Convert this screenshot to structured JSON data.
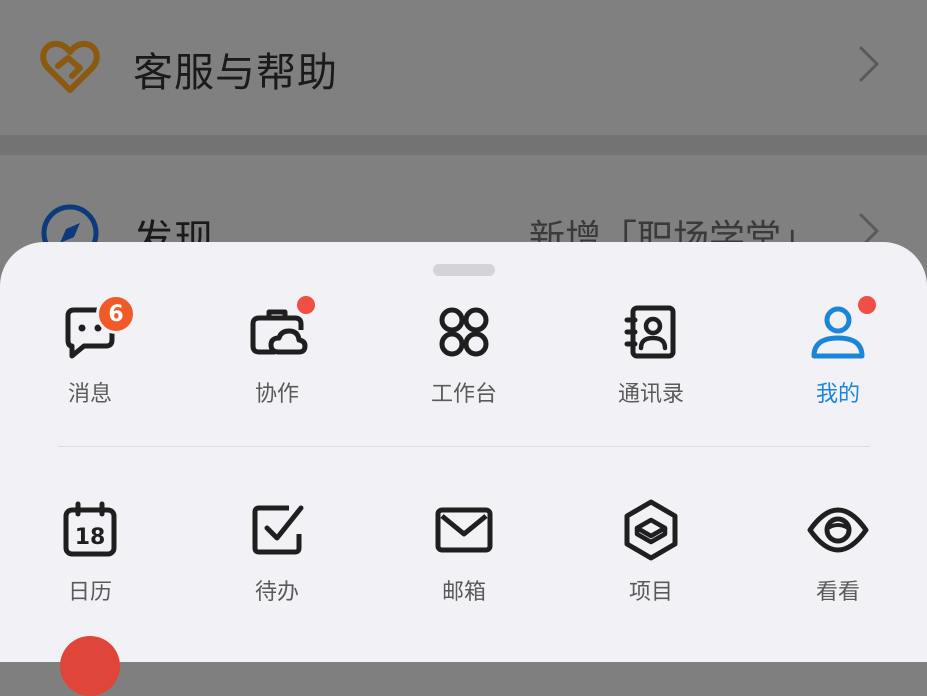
{
  "background": {
    "help_row": {
      "title": "客服与帮助",
      "icon": "heart-hands-icon"
    },
    "discover_row": {
      "title": "发现",
      "value": "新增「职场学堂」",
      "icon": "compass-icon"
    }
  },
  "sheet": {
    "row1": [
      {
        "label": "消息",
        "icon": "chat-bubble-icon",
        "badge": "6"
      },
      {
        "label": "协作",
        "icon": "cloud-briefcase-icon",
        "dot": true
      },
      {
        "label": "工作台",
        "icon": "apps-grid-icon"
      },
      {
        "label": "通讯录",
        "icon": "contacts-book-icon"
      },
      {
        "label": "我的",
        "icon": "person-icon",
        "dot": true,
        "active": true
      }
    ],
    "row2": [
      {
        "label": "日历",
        "icon": "calendar-icon",
        "day": "18"
      },
      {
        "label": "待办",
        "icon": "checkbox-icon"
      },
      {
        "label": "邮箱",
        "icon": "mail-icon"
      },
      {
        "label": "项目",
        "icon": "project-cube-icon"
      },
      {
        "label": "看看",
        "icon": "eye-icon"
      }
    ]
  },
  "colors": {
    "accent": "#1a86d8",
    "badge": "#ef5a28",
    "dot": "#ef4f45",
    "icon": "#1f1f1f"
  }
}
